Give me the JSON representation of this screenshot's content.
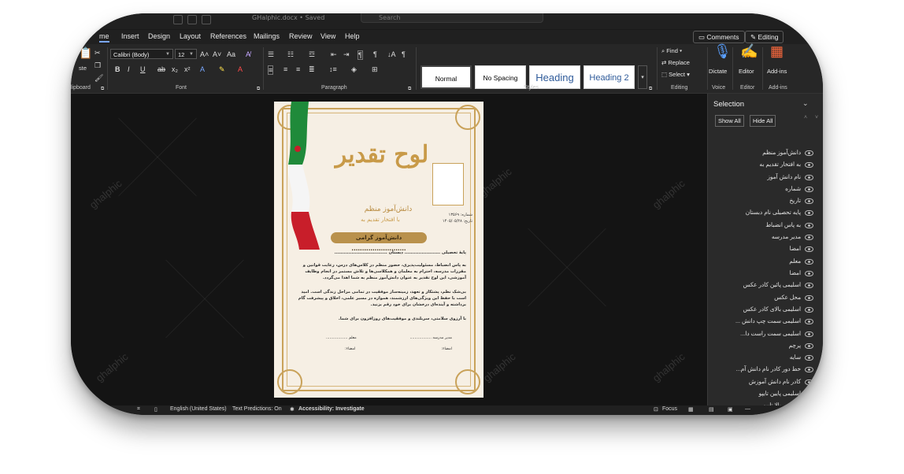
{
  "titlebar": {
    "doc_name": "GHalphic.docx • Saved",
    "search_placeholder": "Search"
  },
  "menu": {
    "tabs": [
      "me",
      "Insert",
      "Design",
      "Layout",
      "References",
      "Mailings",
      "Review",
      "View",
      "Help"
    ],
    "comments": "Comments",
    "editing": "Editing"
  },
  "ribbon": {
    "clipboard": {
      "paste": "ste",
      "label": "lipboard"
    },
    "font": {
      "name": "Calibri (Body)",
      "size": "12",
      "label": "Font"
    },
    "paragraph": {
      "label": "Paragraph"
    },
    "styles": {
      "items": [
        "Normal",
        "No Spacing",
        "Heading",
        "Heading 2"
      ],
      "label": "Styles"
    },
    "editing": {
      "find": "Find",
      "replace": "Replace",
      "select": "Select",
      "label": "Editing"
    },
    "voice": {
      "dictate": "Dictate",
      "label": "Voice"
    },
    "editor": {
      "name": "Editor",
      "label": "Editor"
    },
    "addins": {
      "name": "Add-ins",
      "label": "Add-ins"
    },
    "accent_color": "#7aa7ff"
  },
  "watermark": "ghalphic",
  "page": {
    "title": "لوح تقدیر",
    "subtitle1": "دانش‌آموز منظم",
    "subtitle2": "با افتخار تقدیم به",
    "number": "شماره: ۱۳۵۶۹",
    "date": "تاریخ: ۱۴۰۵/۰۵/۲۸",
    "banner": "دانش‌آموز گرامی ..........................",
    "grade": "پایهٔ تحصیلی ....................... دبستان ..................................",
    "para1": "به پاس انضباط، مسئولیت‌پذیری، حضور منظم در کلاس‌های درس، رعایت قوانین و مقررات مدرسه، احترام به معلمان و همکلاسی‌ها و تلاش مستمر در انجام وظایف آموزشی، این لوح تقدیر به عنوان دانش‌آموز منظم به شما اهدا می‌گردد.",
    "para2": "بی‌شک نظم، پشتکار و تعهد، زمینه‌ساز موفقیت در تمامی مراحل زندگی است. امید است با حفظ این ویژگی‌های ارزشمند، همواره در مسیر علمی، اخلاق و پیشرفت گام برداشته و آینده‌ای درخشان برای خود رقم بزنید.",
    "para3": "با آرزوی سلامتی، سربلندی و موفقیت‌های روزافزون برای شما.",
    "principal": "مدیر مدرسه ..................",
    "teacher": "معلم ..................",
    "sign1": "امضاء:",
    "sign2": "امضاء:"
  },
  "selection": {
    "title": "Selection",
    "show_all": "Show All",
    "hide_all": "Hide All",
    "items": [
      "دانش‌آموز منظم",
      "به افتخار تقدیم به",
      "نام دانش آموز",
      "شماره",
      "تاریخ",
      "پایه تحصیلی نام دبستان",
      "به پاس انضباط",
      "مدیر مدرسه",
      "امضا",
      "معلم",
      "امضا",
      "اسلیمی پائین کادر عکس",
      "محل عکس",
      "اسلیمی بالای کادر عکس",
      "اسلیمی سمت چپ دانش ...",
      "اسلیمی سمت راست دا...",
      "پرچم",
      "سایه",
      "خط دور کادر نام دانش آم...",
      "کادر نام دانش آموزش",
      "اسلیمی پایین تایپو",
      "اسلیمی بالا تایپو"
    ]
  },
  "status": {
    "language": "English (United States)",
    "predictions": "Text Predictions: On",
    "accessibility": "Accessibility: Investigate",
    "focus": "Focus"
  }
}
